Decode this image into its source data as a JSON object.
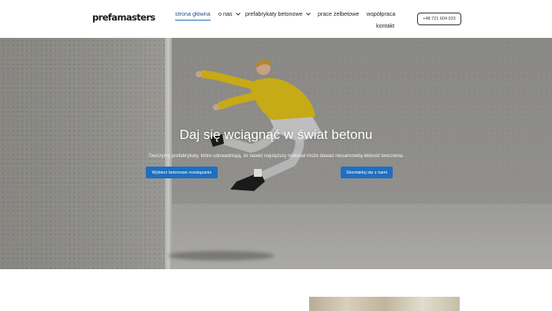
{
  "brand": {
    "logo_text": "prefamasters"
  },
  "nav": {
    "items": [
      {
        "label": "strona główna",
        "active": true,
        "has_dropdown": false
      },
      {
        "label": "o nas",
        "active": false,
        "has_dropdown": true
      },
      {
        "label": "prefabrykaty betonowe",
        "active": false,
        "has_dropdown": true
      },
      {
        "label": "prace żelbetowe",
        "active": false,
        "has_dropdown": false
      },
      {
        "label": "współpraca",
        "active": false,
        "has_dropdown": false
      },
      {
        "label": "kontakt",
        "active": false,
        "has_dropdown": false
      }
    ],
    "dropdown_icon": "chevron-down-icon",
    "phone_button": "+48 721 604 023"
  },
  "hero": {
    "title": "Daj się wciągnąć w świat betonu",
    "subtitle": "Tworzymy prefabrykaty, które udowadniają, że nawet najcięższy materiał może dawać niesamowitą lekkość tworzenia.",
    "cta_primary": "Wybierz betonowe rozwiązanie",
    "cta_secondary": "Skontaktuj się z nami"
  },
  "colors": {
    "accent": "#1f6fbf",
    "active_nav": "#1f4f86",
    "hoodie": "#e2c21a"
  }
}
